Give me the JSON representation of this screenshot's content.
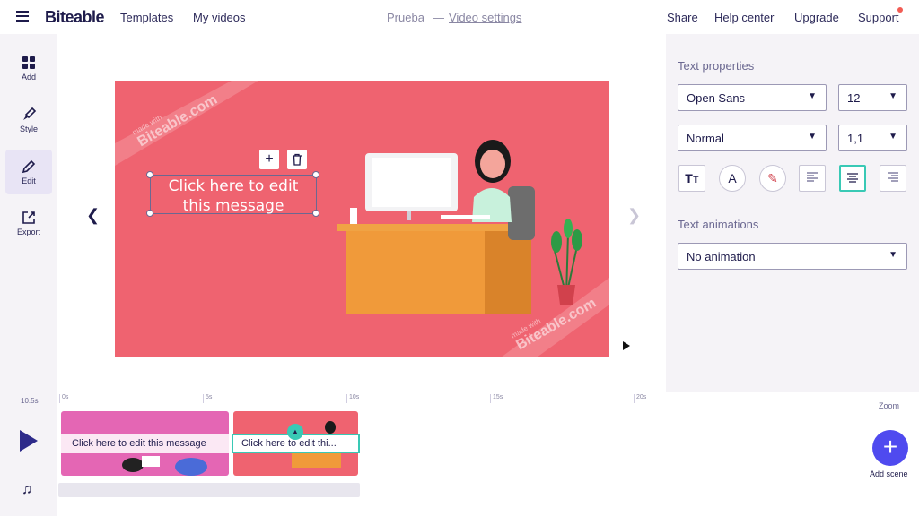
{
  "header": {
    "logo": "Biteable",
    "nav": [
      "Templates",
      "My videos"
    ],
    "project_name": "Prueba",
    "separator": "—",
    "video_settings": "Video settings",
    "right_nav": [
      "Share",
      "Help center",
      "Upgrade",
      "Support"
    ]
  },
  "sidebar": {
    "items": [
      {
        "label": "Add",
        "icon": "grid-icon"
      },
      {
        "label": "Style",
        "icon": "brush-icon"
      },
      {
        "label": "Edit",
        "icon": "pencil-icon",
        "active": true
      },
      {
        "label": "Export",
        "icon": "export-icon"
      }
    ]
  },
  "scene": {
    "text_line1": "Click here to edit",
    "text_line2": "this message",
    "watermark_small": "made with",
    "watermark_big": "Biteable.com",
    "add_symbol": "+",
    "delete_symbol": "🗑",
    "bg_color": "#ef6370"
  },
  "text_properties": {
    "title": "Text properties",
    "font": "Open Sans",
    "size": "12",
    "weight": "Normal",
    "line_height": "1,1",
    "format_buttons": [
      {
        "name": "text-size-icon",
        "glyph": "Tт"
      },
      {
        "name": "text-color-icon",
        "glyph": "A"
      },
      {
        "name": "highlight-icon",
        "glyph": "✎"
      },
      {
        "name": "align-left-icon",
        "glyph": "≡"
      },
      {
        "name": "align-center-icon",
        "glyph": "≡"
      },
      {
        "name": "align-right-icon",
        "glyph": "≡"
      }
    ],
    "animations_title": "Text animations",
    "animation": "No animation",
    "accent_color": "#39c9b5"
  },
  "timeline": {
    "duration": "10.5s",
    "ticks": [
      "0s",
      "5s",
      "10s",
      "15s",
      "20s"
    ],
    "clips": [
      {
        "label": "Click here to edit this message"
      },
      {
        "label": "Click here to edit thi..."
      }
    ],
    "zoom": "Zoom",
    "add_scene": "Add scene"
  }
}
